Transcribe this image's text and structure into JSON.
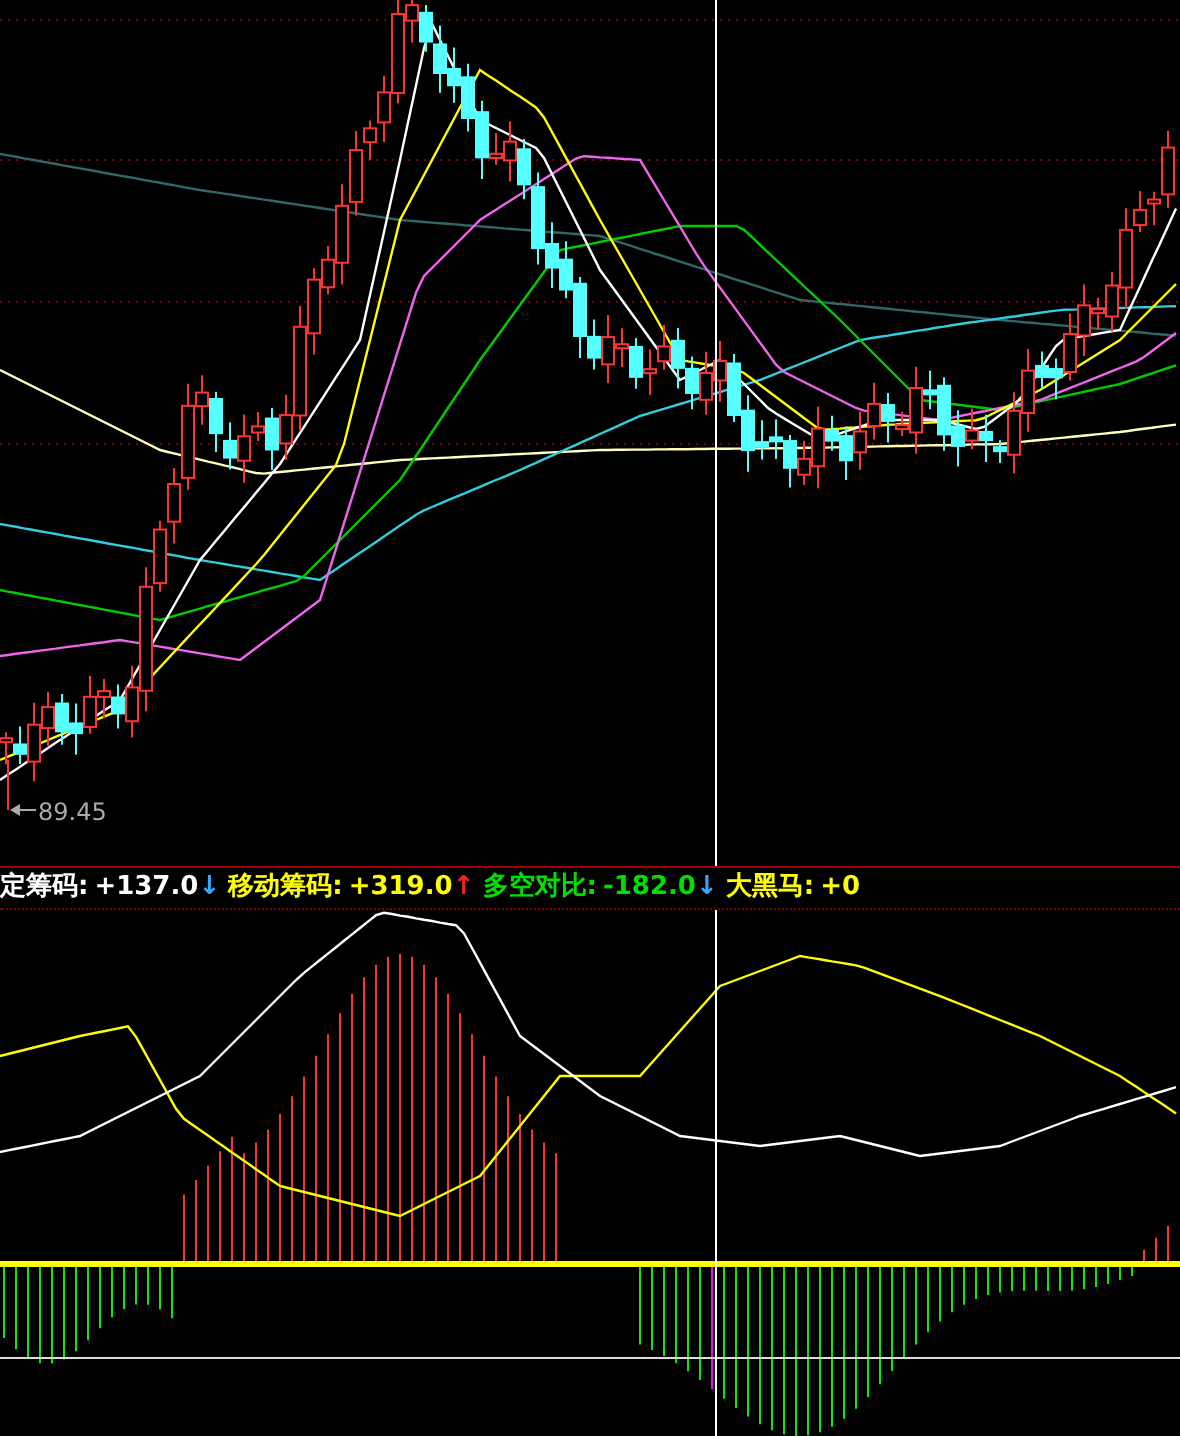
{
  "main_chart": {
    "low_marker": {
      "value": "89.45"
    }
  },
  "indicators": [
    {
      "label": "定筹码:",
      "value": "+137.0",
      "arrow": {
        "text": "↓",
        "color": "#33aaff"
      },
      "kind": "fixed"
    },
    {
      "label": "移动筹码:",
      "value": "+319.0",
      "arrow": {
        "text": "↑",
        "color": "#ff2020"
      },
      "kind": "moving"
    },
    {
      "label": "多空对比:",
      "value": "-182.0",
      "arrow": {
        "text": "↓",
        "color": "#33aaff"
      },
      "kind": "ratio"
    },
    {
      "label": "大黑马:",
      "value": "+0",
      "kind": "signal"
    }
  ]
}
